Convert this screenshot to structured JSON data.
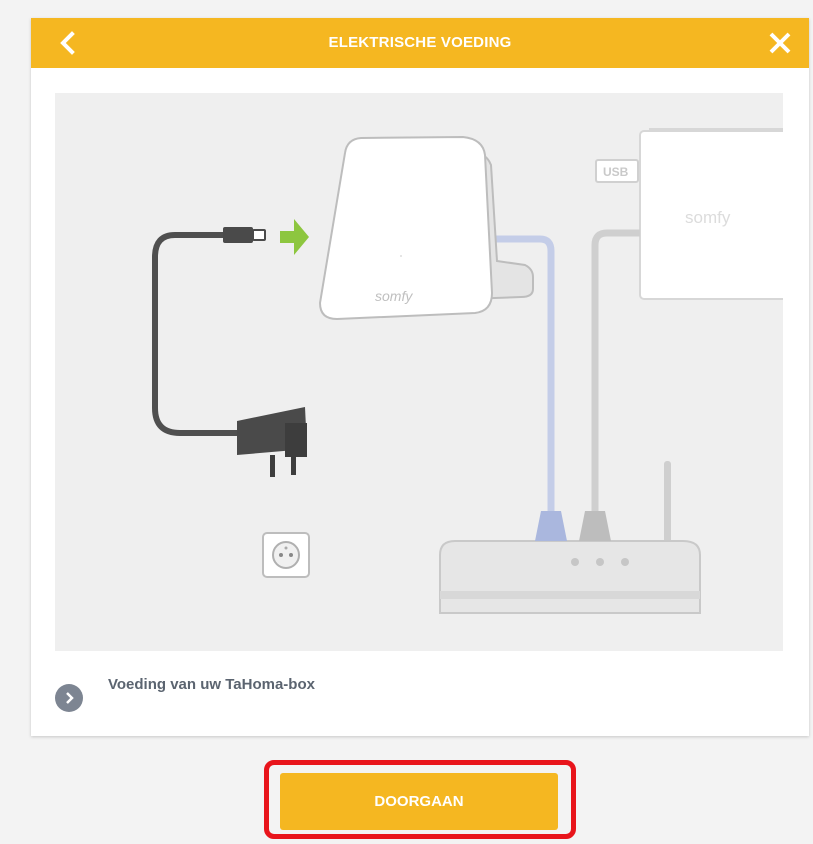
{
  "header": {
    "title": "ELEKTRISCHE VOEDING",
    "back_icon": "chevron-left-icon",
    "close_icon": "close-icon",
    "color": "#f5b721"
  },
  "illustration": {
    "router_brand": "somfy",
    "device_brand": "somfy",
    "usb_label": "USB",
    "arrow_color": "#8dc63f"
  },
  "info": {
    "label": "Voeding van uw TaHoma-box",
    "icon": "chevron-right-icon"
  },
  "footer": {
    "continue_label": "DOORGAAN",
    "highlight_color": "#e8141b"
  }
}
